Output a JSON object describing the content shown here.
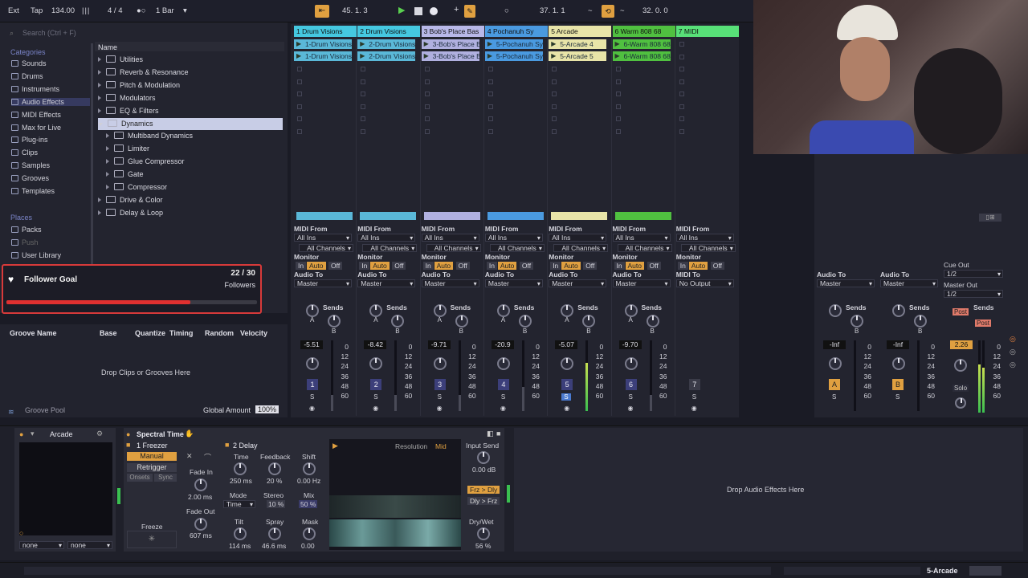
{
  "transport": {
    "ext": "Ext",
    "tap": "Tap",
    "tempo": "134.00",
    "signature": "4 / 4",
    "quantize": "1 Bar",
    "position": "45.   1.   3",
    "loop_start": "37.   1.   1",
    "loop_len": "32.   0.   0"
  },
  "browser": {
    "search_placeholder": "Search (Ctrl + F)",
    "categories_header": "Categories",
    "categories": [
      "Sounds",
      "Drums",
      "Instruments",
      "Audio Effects",
      "MIDI Effects",
      "Max for Live",
      "Plug-ins",
      "Clips",
      "Samples",
      "Grooves",
      "Templates"
    ],
    "places_header": "Places",
    "places": [
      "Packs",
      "Push",
      "User Library"
    ],
    "name_header": "Name",
    "items": [
      "Utilities",
      "Reverb & Resonance",
      "Pitch & Modulation",
      "Modulators",
      "EQ & Filters",
      "Dynamics"
    ],
    "dynamics_children": [
      "Multiband Dynamics",
      "Limiter",
      "Glue Compressor",
      "Gate",
      "Compressor"
    ],
    "items_after": [
      "Drive & Color",
      "Delay & Loop"
    ]
  },
  "follower_goal": {
    "label": "Follower Goal",
    "count": "22 / 30",
    "unit": "Followers",
    "progress": 0.733
  },
  "groove": {
    "headers": [
      "Groove Name",
      "Base",
      "Quantize",
      "Timing",
      "Random",
      "Velocity"
    ],
    "drop_text": "Drop Clips or Grooves Here",
    "pool_label": "Groove Pool",
    "global_amount_label": "Global Amount",
    "global_amount": "100%"
  },
  "tracks": [
    {
      "name": "1 Drum Visions",
      "color": "#45c8e0",
      "clips": [
        "1-Drum Visions",
        "1-Drum Visions"
      ],
      "clip_color": "#5ab8d8",
      "input": "MIDI From",
      "in_val": "All Ins",
      "channel": "All Channels",
      "out_label": "Audio To",
      "out_val": "Master",
      "vol": "-5.51",
      "num": "1"
    },
    {
      "name": "2 Drum Visions",
      "color": "#45c8e0",
      "clips": [
        "2-Drum Visions",
        "2-Drum Visions"
      ],
      "clip_color": "#5ab8d8",
      "input": "MIDI From",
      "in_val": "All Ins",
      "channel": "All Channels",
      "out_label": "Audio To",
      "out_val": "Master",
      "vol": "-8.42",
      "num": "2"
    },
    {
      "name": "3 Bob's Place Bas",
      "color": "#b8b8e8",
      "clips": [
        "3-Bob's Place B",
        "3-Bob's Place B"
      ],
      "clip_color": "#b0b0e0",
      "input": "MIDI From",
      "in_val": "All Ins",
      "channel": "All Channels",
      "out_label": "Audio To",
      "out_val": "Master",
      "vol": "-9.71",
      "num": "3"
    },
    {
      "name": "4 Pochanuh Sy",
      "color": "#4a9ae0",
      "clips": [
        "5-Pochanuh Sy",
        "5-Pochanuh Sy"
      ],
      "clip_color": "#4a9ae0",
      "input": "MIDI From",
      "in_val": "All Ins",
      "channel": "All Channels",
      "out_label": "Audio To",
      "out_val": "Master",
      "vol": "-20.9",
      "num": "4"
    },
    {
      "name": "5 Arcade",
      "color": "#e8e4a8",
      "clips": [
        "5-Arcade 4",
        "5-Arcade 5"
      ],
      "clip_color": "#e8e4a8",
      "input": "MIDI From",
      "in_val": "All Ins",
      "channel": "All Channels",
      "out_label": "Audio To",
      "out_val": "Master",
      "vol": "-5.07",
      "num": "5"
    },
    {
      "name": "6 Warm 808 68",
      "color": "#50c040",
      "clips": [
        "6-Warm 808 68",
        "6-Warm 808 68"
      ],
      "clip_color": "#50c040",
      "input": "MIDI From",
      "in_val": "All Ins",
      "channel": "All Channels",
      "out_label": "Audio To",
      "out_val": "Master",
      "vol": "-9.70",
      "num": "6"
    },
    {
      "name": "7 MIDI",
      "color": "#58e078",
      "clips": [],
      "clip_color": "#58e078",
      "input": "MIDI From",
      "in_val": "All Ins",
      "channel": "All Channels",
      "out_label": "MIDI To",
      "out_val": "No Output",
      "vol": "",
      "num": "7"
    }
  ],
  "mixer_labels": {
    "monitor": "Monitor",
    "in": "In",
    "auto": "Auto",
    "off": "Off",
    "sends": "Sends",
    "a": "A",
    "b": "B",
    "s": "S"
  },
  "meter_scale": [
    "0",
    "12",
    "24",
    "36",
    "48",
    "60"
  ],
  "returns": [
    {
      "out_label": "Audio To",
      "out_val": "Master",
      "vol": "-Inf",
      "letter": "A"
    },
    {
      "out_label": "Audio To",
      "out_val": "Master",
      "vol": "-Inf",
      "letter": "B"
    }
  ],
  "master": {
    "cue_label": "Cue Out",
    "cue_val": "1/2",
    "out_label": "Master Out",
    "out_val": "1/2",
    "vol": "2.26",
    "post": "Post",
    "solo": "Solo"
  },
  "device": {
    "instrument": "Arcade",
    "plugin": "Spectral Time",
    "freezer_label": "1 Freezer",
    "manual": "Manual",
    "retrigger": "Retrigger",
    "onsets": "Onsets",
    "sync": "Sync",
    "fade_in_label": "Fade In",
    "fade_in": "2.00 ms",
    "fade_out_label": "Fade Out",
    "fade_out": "607 ms",
    "freeze_label": "Freeze",
    "delay_label": "2 Delay",
    "time_label": "Time",
    "time": "250 ms",
    "feedback_label": "Feedback",
    "feedback": "20 %",
    "shift_label": "Shift",
    "shift": "0.00 Hz",
    "mode_label": "Mode",
    "mode": "Time",
    "stereo_label": "Stereo",
    "stereo": "10 %",
    "mix_label": "Mix",
    "mix": "50 %",
    "tilt_label": "Tilt",
    "tilt": "114 ms",
    "spray_label": "Spray",
    "spray": "46.6 ms",
    "mask_label": "Mask",
    "mask": "0.00",
    "resolution_label": "Resolution",
    "resolution": "Mid",
    "input_send_label": "Input Send",
    "input_send": "0.00 dB",
    "frz_dly": "Frz > Dly",
    "dly_frz": "Dly > Frz",
    "drywet_label": "Dry/Wet",
    "drywet": "56 %",
    "none1": "none",
    "none2": "none",
    "drop_text": "Drop Audio Effects Here"
  },
  "status": {
    "track": "5-Arcade"
  }
}
